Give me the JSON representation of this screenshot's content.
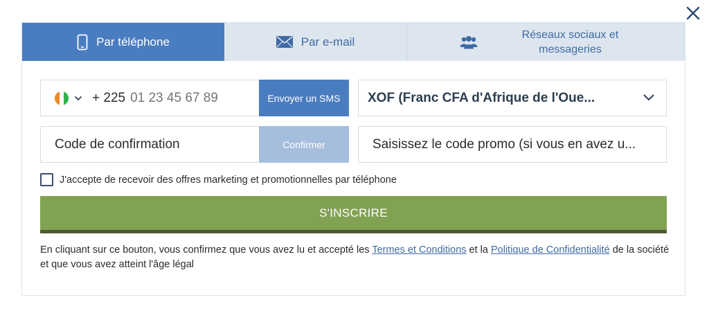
{
  "colors": {
    "tab_active": "#4a7cc0",
    "tab_inactive": "#dde6ef",
    "primary_button": "#4a7cc0",
    "confirm_disabled": "#a6bedd",
    "submit_green": "#82a253",
    "link": "#3f6aa3"
  },
  "tabs": [
    {
      "label": "Par téléphone",
      "icon": "smartphone-icon",
      "active": true
    },
    {
      "label": "Par e-mail",
      "icon": "envelope-icon",
      "active": false
    },
    {
      "label": "Réseaux sociaux et messageries",
      "icon": "users-icon",
      "active": false
    }
  ],
  "phone": {
    "country_flag": "cote-divoire-flag-icon",
    "prefix": "+ 225",
    "placeholder": "01 23 45 67 89",
    "sms_button": "Envoyer un SMS"
  },
  "currency": {
    "selected": "XOF (Franc CFA d'Afrique de l'Oue..."
  },
  "confirmation": {
    "placeholder": "Code de confirmation",
    "confirm_button": "Confirmer"
  },
  "promo": {
    "placeholder": "Saisissez le code promo (si vous en avez u..."
  },
  "consent": {
    "label": "J'accepte de recevoir des offres marketing et promotionnelles par téléphone"
  },
  "submit": {
    "label": "S'INSCRIRE"
  },
  "legal": {
    "part1": "En cliquant sur ce bouton, vous confirmez que vous avez lu et accepté les ",
    "terms_link": "Termes et Conditions",
    "part2": " et la ",
    "privacy_link": "Politique de Confidentialité",
    "part3": " de la société et que vous avez atteint l'âge légal"
  }
}
